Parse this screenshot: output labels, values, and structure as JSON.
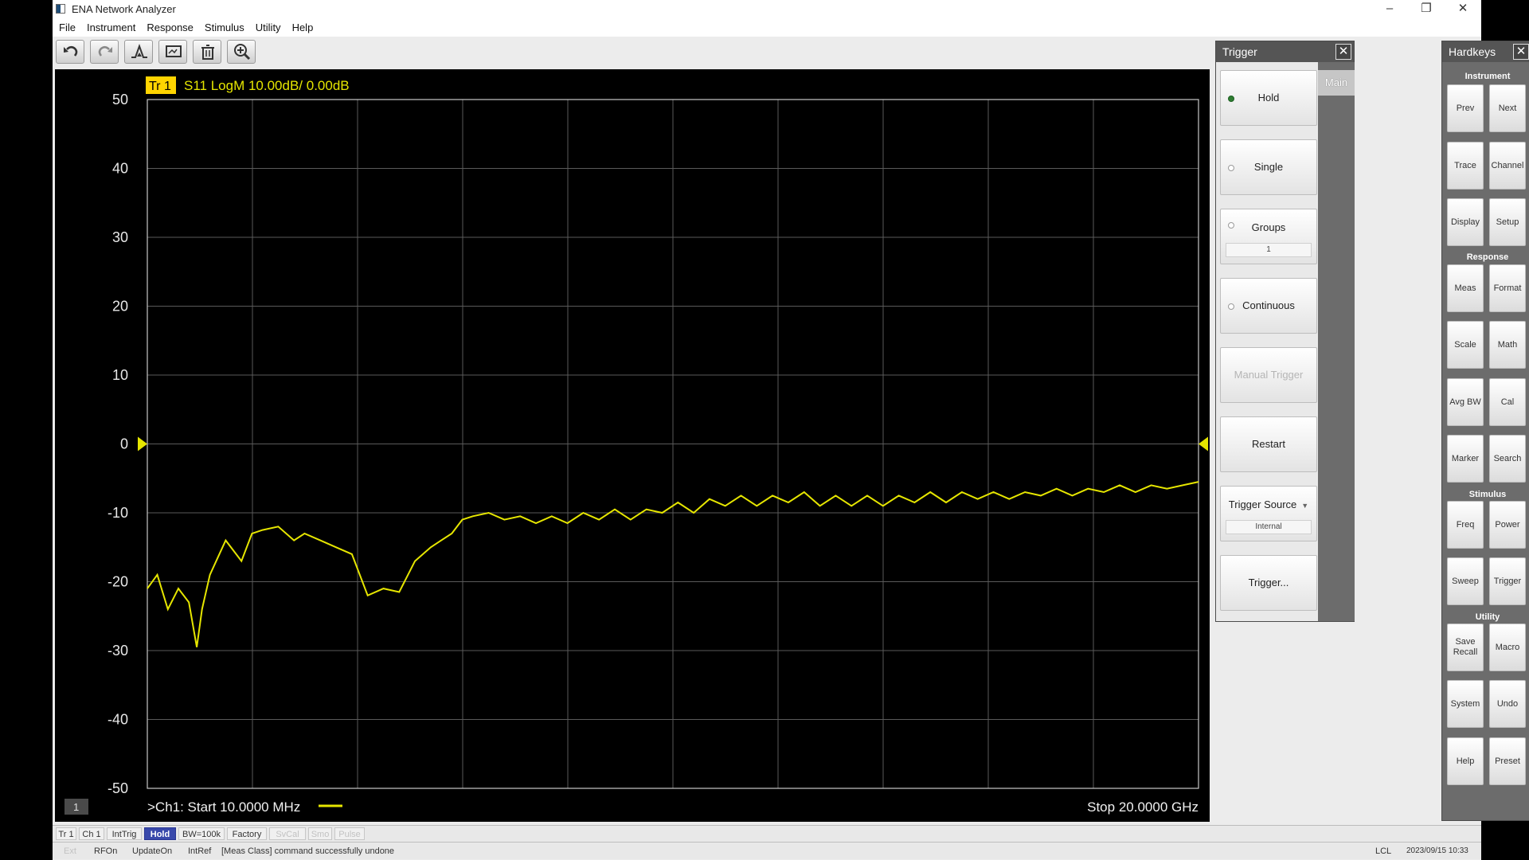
{
  "window": {
    "title": "ENA Network Analyzer",
    "minimize": "–",
    "restore": "❐",
    "close": "✕"
  },
  "menu": [
    "File",
    "Instrument",
    "Response",
    "Stimulus",
    "Utility",
    "Help"
  ],
  "toolbar": {
    "icons": [
      "undo-icon",
      "redo-icon",
      "marker-icon",
      "screen-icon",
      "trash-icon",
      "zoom-icon"
    ]
  },
  "trace_header": {
    "tag": "Tr 1",
    "text": "S11 LogM 10.00dB/  0.00dB"
  },
  "chart_data": {
    "type": "line",
    "trace": "S11 LogM 10.00dB/  0.00dB",
    "ylim": [
      -50,
      50
    ],
    "yticks": [
      50,
      40,
      30,
      20,
      10,
      0,
      -10,
      -20,
      -30,
      -40,
      -50
    ],
    "reference_level": 0,
    "xlim": [
      0.01,
      20
    ],
    "x_unit": "GHz",
    "grid": true,
    "trace_color": "#e6e600",
    "series": [
      {
        "x": [
          0.01,
          0.2,
          0.4,
          0.6,
          0.8,
          0.95,
          1.05,
          1.2,
          1.5,
          1.8,
          2.0,
          2.2,
          2.5,
          2.8,
          3.0,
          3.3,
          3.6,
          3.9,
          4.2,
          4.5,
          4.8,
          5.1,
          5.4,
          5.6,
          5.8,
          6.0,
          6.2,
          6.5,
          6.8,
          7.1,
          7.4,
          7.7,
          8.0,
          8.3,
          8.6,
          8.9,
          9.2,
          9.5,
          9.8,
          10.1,
          10.4,
          10.7,
          11.0,
          11.3,
          11.6,
          11.9,
          12.2,
          12.5,
          12.8,
          13.1,
          13.4,
          13.7,
          14.0,
          14.3,
          14.6,
          14.9,
          15.2,
          15.5,
          15.8,
          16.1,
          16.4,
          16.7,
          17.0,
          17.3,
          17.6,
          17.9,
          18.2,
          18.5,
          18.8,
          19.1,
          19.4,
          19.7,
          20.0
        ],
        "y": [
          -21,
          -19,
          -24,
          -21,
          -23,
          -29.5,
          -24,
          -19,
          -14,
          -17,
          -13,
          -12.5,
          -12,
          -14,
          -13,
          -14,
          -15,
          -16,
          -22,
          -21,
          -21.5,
          -17,
          -15,
          -14,
          -13,
          -11,
          -10.5,
          -10,
          -11,
          -10.5,
          -11.5,
          -10.5,
          -11.5,
          -10,
          -11,
          -9.5,
          -11,
          -9.5,
          -10,
          -8.5,
          -10,
          -8,
          -9,
          -7.5,
          -9,
          -7.5,
          -8.5,
          -7,
          -9,
          -7.5,
          -9,
          -7.5,
          -9,
          -7.5,
          -8.5,
          -7,
          -8.5,
          -7,
          -8,
          -7,
          -8,
          -7,
          -7.5,
          -6.5,
          -7.5,
          -6.5,
          -7,
          -6,
          -7,
          -6,
          -6.5,
          -6,
          -5.5
        ]
      }
    ]
  },
  "chart_footer": {
    "start": ">Ch1:  Start   10.0000 MHz",
    "stop": "Stop  20.0000 GHz",
    "channel": "1"
  },
  "status1": [
    {
      "label": "Tr 1",
      "state": "normal"
    },
    {
      "label": "Ch 1",
      "state": "normal"
    },
    {
      "label": "IntTrig",
      "state": "normal"
    },
    {
      "label": "Hold",
      "state": "on"
    },
    {
      "label": "BW=100k",
      "state": "normal"
    },
    {
      "label": "Factory",
      "state": "normal"
    },
    {
      "label": "SvCal",
      "state": "dim"
    },
    {
      "label": "Smo",
      "state": "dim"
    },
    {
      "label": "Pulse",
      "state": "dim"
    }
  ],
  "status2": {
    "ext": "Ext",
    "rfon": "RFOn",
    "update": "UpdateOn",
    "ref": "IntRef",
    "message": "[Meas Class] command successfully undone",
    "lcl": "LCL",
    "datetime": "2023/09/15 10:33"
  },
  "trigger_panel": {
    "title": "Trigger",
    "tab": "Main",
    "hold": "Hold",
    "single": "Single",
    "groups": "Groups",
    "groups_value": "1",
    "continuous": "Continuous",
    "manual_trigger": "Manual Trigger",
    "restart": "Restart",
    "trigger_source": "Trigger Source",
    "trigger_source_value": "Internal",
    "trigger_more": "Trigger..."
  },
  "hardkeys": {
    "title": "Hardkeys",
    "instrument": "Instrument",
    "response": "Response",
    "stimulus": "Stimulus",
    "utility": "Utility",
    "prev": "Prev",
    "next": "Next",
    "trace": "Trace",
    "channel": "Channel",
    "display": "Display",
    "setup": "Setup",
    "meas": "Meas",
    "format": "Format",
    "scale": "Scale",
    "math": "Math",
    "avgbw": "Avg BW",
    "cal": "Cal",
    "marker": "Marker",
    "search": "Search",
    "freq": "Freq",
    "power": "Power",
    "sweep": "Sweep",
    "trigger": "Trigger",
    "save1": "Save",
    "save2": "Recall",
    "macro": "Macro",
    "system": "System",
    "undo": "Undo",
    "help": "Help",
    "preset": "Preset"
  }
}
